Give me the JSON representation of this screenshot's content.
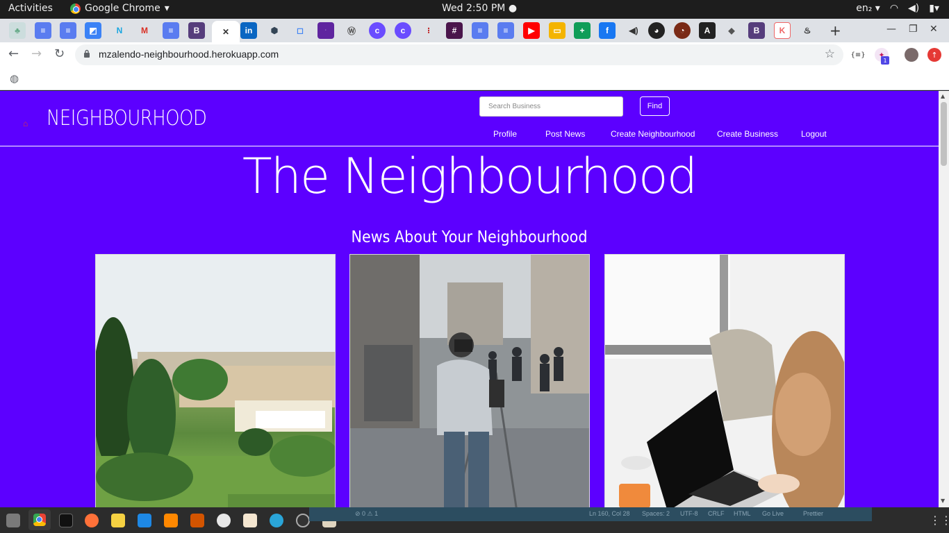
{
  "system": {
    "activities": "Activities",
    "app_name": "Google Chrome",
    "clock": "Wed  2:50 PM",
    "lang": "en₂"
  },
  "browser": {
    "url": "mzalendo-neighbourhood.herokuapp.com",
    "ext_badge": "1",
    "ext_code": "{≡}"
  },
  "site": {
    "brand": "NEIGHBOURHOOD",
    "search_placeholder": "Search Business",
    "find_label": "Find",
    "nav": [
      "Profile",
      "Post News",
      "Create Neighbourhood",
      "Create Business",
      "Logout"
    ],
    "hero_title": "The Neighbourhood",
    "news_heading": "News About Your Neighbourhood"
  },
  "status_bar": {
    "problems": "⊘ 0 ⚠ 1",
    "position": "Ln 160, Col 28",
    "spaces": "Spaces: 2",
    "encoding": "UTF-8",
    "eol": "CRLF",
    "language": "HTML",
    "go_live": "Go Live",
    "prettier": "Prettier"
  },
  "colors": {
    "site_bg": "#5c00ff",
    "accent": "#ffffff"
  }
}
